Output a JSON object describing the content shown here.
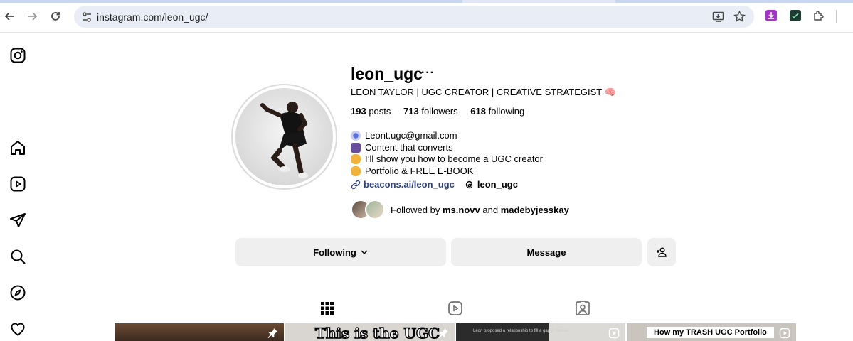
{
  "browser": {
    "url": "instagram.com/leon_ugc/",
    "back_icon": "arrow-left-icon",
    "forward_icon": "arrow-right-icon",
    "reload_icon": "reload-icon"
  },
  "sidebar": {
    "items": [
      "instagram-logo",
      "home",
      "reels",
      "messages",
      "search",
      "explore",
      "notifications"
    ]
  },
  "profile": {
    "username": "leon_ugc",
    "more": "···",
    "full_name": "LEON TAYLOR | UGC CREATOR | CREATIVE STRATEGIST 🧠",
    "stats": {
      "posts_num": "193",
      "posts_label": "posts",
      "followers_num": "713",
      "followers_label": "followers",
      "following_num": "618",
      "following_label": "following"
    },
    "bio": [
      "Leont.ugc@gmail.com",
      "Content that converts",
      "I’ll show you how to become a UGC creator",
      "Portfolio & FREE E-BOOK"
    ],
    "link": "beacons.ai/leon_ugc",
    "threads_handle": "leon_ugc",
    "followed_by_prefix": "Followed by",
    "followed_by_1": "ms.novv",
    "followed_by_and": "and",
    "followed_by_2": "madebyjesskay"
  },
  "actions": {
    "following_label": "Following",
    "message_label": "Message"
  },
  "thumbnails": {
    "post2_text": "This is the UGC",
    "post3_text": "Leon proposed a relationship to fill a gap in Sprout",
    "post5_text": "How my TRASH UGC Portfolio"
  },
  "colors": {
    "link": "#31437a",
    "button_bg": "#efefef",
    "omnibox_bg": "#e9eef6"
  }
}
